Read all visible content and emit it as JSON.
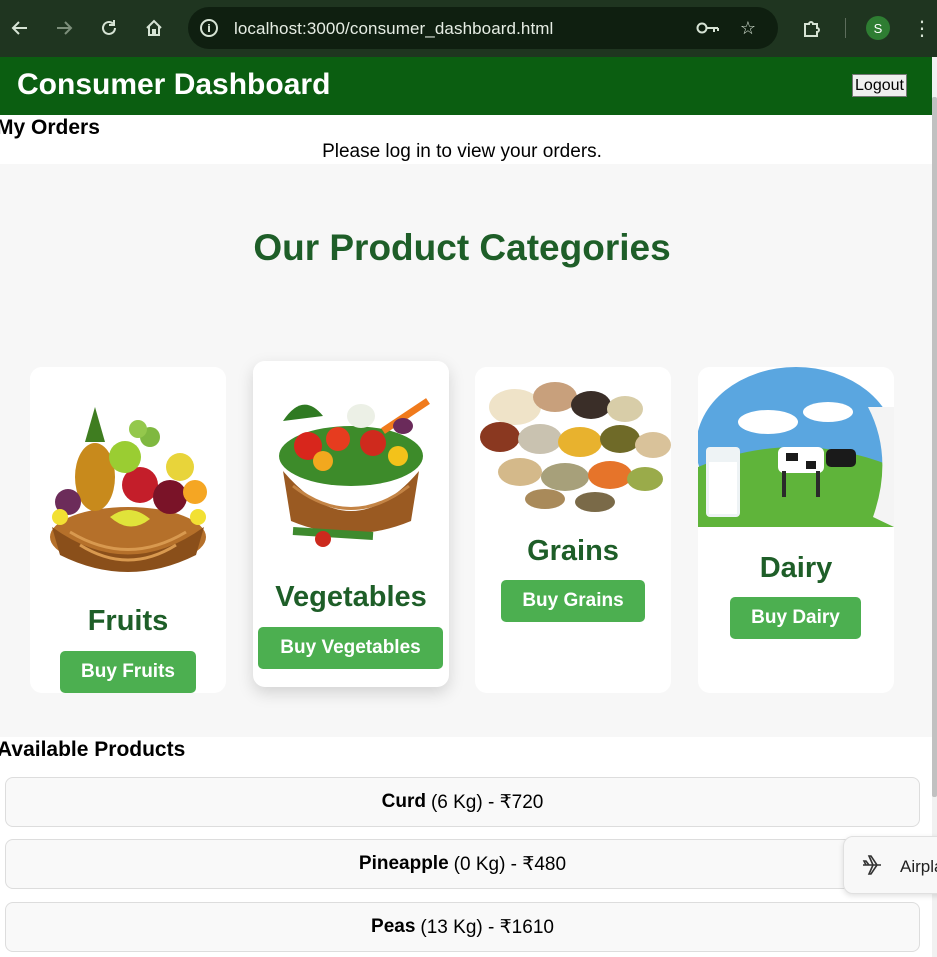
{
  "browser": {
    "url": "localhost:3000/consumer_dashboard.html",
    "profile_initial": "S",
    "icons": [
      "back-arrow-icon",
      "forward-arrow-icon",
      "reload-icon",
      "home-icon",
      "site-info-icon",
      "password-key-icon",
      "bookmark-star-icon",
      "extensions-puzzle-icon",
      "kebab-menu-icon"
    ]
  },
  "header": {
    "title": "Consumer Dashboard",
    "logout_label": "Logout",
    "background": "#0b5e11"
  },
  "orders": {
    "heading": "My Orders",
    "message": "Please log in to view your orders."
  },
  "categories": {
    "heading": "Our Product Categories",
    "accent": "#1e5e28",
    "button_color": "#4caf50",
    "items": [
      {
        "name": "Fruits",
        "button": "Buy Fruits",
        "image": "fruit-basket"
      },
      {
        "name": "Vegetables",
        "button": "Buy Vegetables",
        "image": "vegetable-basket"
      },
      {
        "name": "Grains",
        "button": "Buy Grains",
        "image": "grain-sacks"
      },
      {
        "name": "Dairy",
        "button": "Buy Dairy",
        "image": "dairy-cows-milk"
      }
    ]
  },
  "products": {
    "heading": "Available Products",
    "items": [
      {
        "name": "Curd",
        "detail": "(6 Kg) - ₹720"
      },
      {
        "name": "Pineapple",
        "detail": "(0 Kg) - ₹480"
      },
      {
        "name": "Peas",
        "detail": "(13 Kg) - ₹1610"
      }
    ]
  },
  "toast": {
    "text": "Airpla",
    "icon": "airplane-icon"
  }
}
